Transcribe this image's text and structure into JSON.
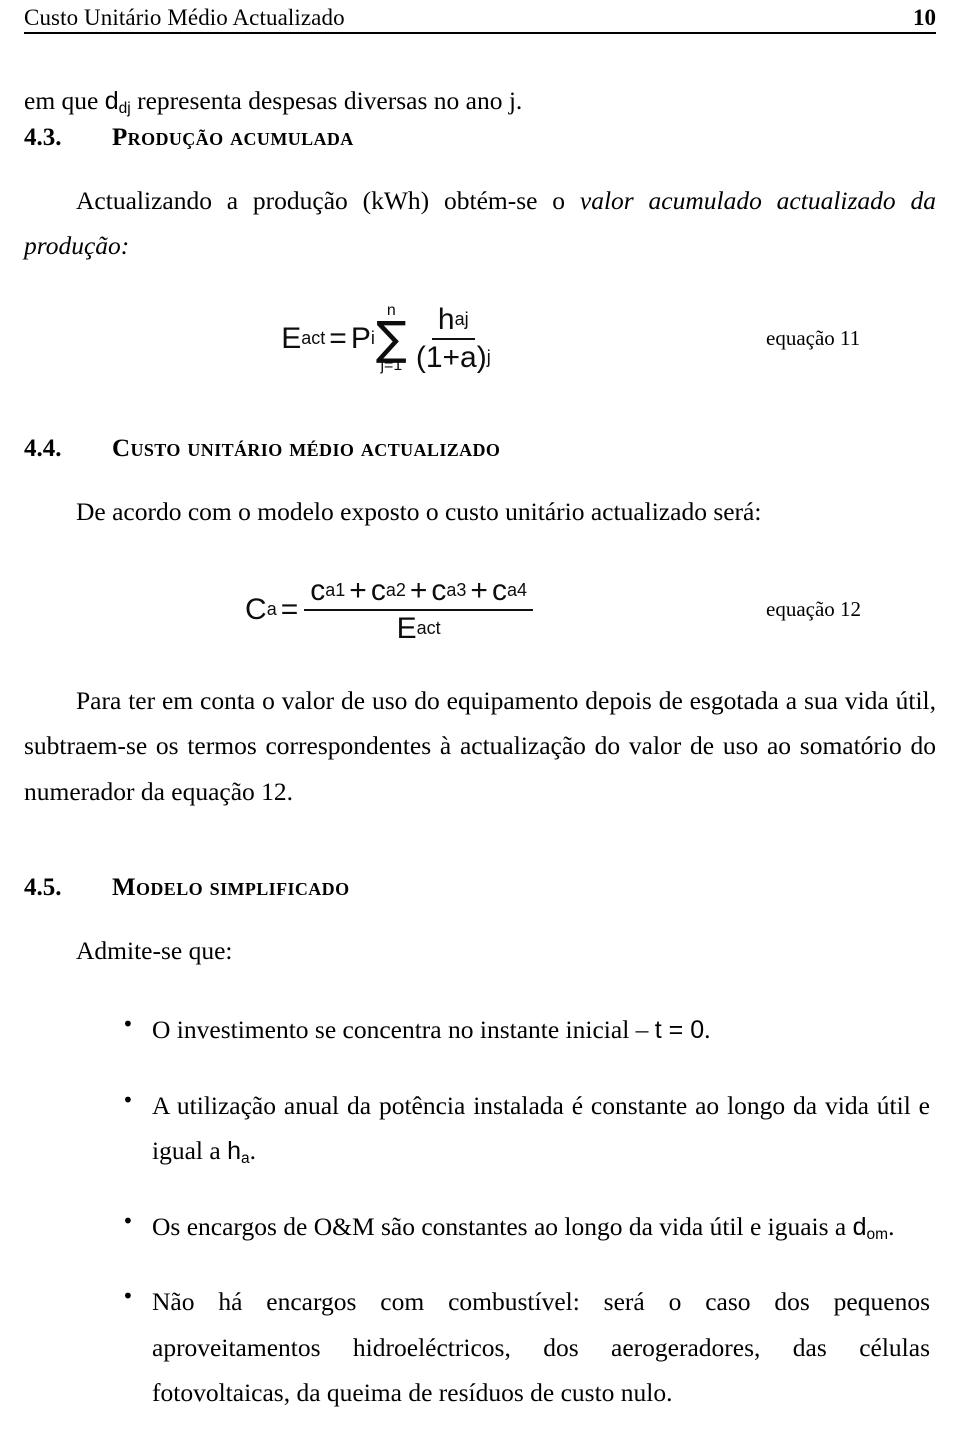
{
  "header": {
    "title": "Custo Unitário Médio Actualizado",
    "page_number": "10"
  },
  "intro": {
    "text_before": "em que ",
    "symbol": "d",
    "symbol_sub": "dj",
    "text_after": " representa despesas diversas no ano j."
  },
  "sections": [
    {
      "number": "4.3.",
      "title": "Produção acumulada",
      "paragraph_plain": "Actualizando a produção (kWh) obtém-se o ",
      "paragraph_italic": "valor acumulado actualizado da produção",
      "paragraph_tail": ":"
    },
    {
      "number": "4.4.",
      "title": "Custo unitário médio actualizado",
      "paragraph": "De acordo com o modelo exposto o custo unitário actualizado será:"
    },
    {
      "number": "4.5.",
      "title": "Modelo simplificado",
      "paragraph": "Admite-se que:"
    }
  ],
  "equations": [
    {
      "id": "equation-11",
      "label": "equação 11",
      "lhs_base": "E",
      "lhs_sub": "act",
      "equals": "=",
      "factor_base": "P",
      "factor_sub": "i",
      "sum_upper": "n",
      "sum_lower": "j=1",
      "sigma": "∑",
      "numerator_base": "h",
      "numerator_sub": "aj",
      "denominator": "(1+a)",
      "denominator_sup": "j"
    },
    {
      "id": "equation-12",
      "label": "equação 12",
      "lhs_base": "C",
      "lhs_sub": "a",
      "equals": "=",
      "numerator_terms": [
        {
          "base": "c",
          "sub": "a1"
        },
        {
          "base": "c",
          "sub": "a2"
        },
        {
          "base": "c",
          "sub": "a3"
        },
        {
          "base": "c",
          "sub": "a4"
        }
      ],
      "numerator_operator": "+",
      "denominator_base": "E",
      "denominator_sub": "act"
    }
  ],
  "paragraphs": {
    "after_equation_12": "Para ter em conta o valor de uso do equipamento depois de esgotada a sua vida útil, subtraem-se os termos correspondentes à actualização do valor de uso ao somatório do numerador da equação 12."
  },
  "bullets": {
    "marker": "•",
    "items": [
      {
        "parts": [
          {
            "type": "text",
            "value": "O investimento se concentra no instante inicial – "
          },
          {
            "type": "sym",
            "value": "t = 0"
          },
          {
            "type": "text",
            "value": "."
          }
        ]
      },
      {
        "parts": [
          {
            "type": "text",
            "value": "A utilização anual da potência instalada é constante ao longo da vida útil e igual a "
          },
          {
            "type": "sym_sub",
            "base": "h",
            "sub": "a"
          },
          {
            "type": "text",
            "value": "."
          }
        ]
      },
      {
        "parts": [
          {
            "type": "text",
            "value": "Os encargos de O&M são constantes ao longo da vida útil e iguais a "
          },
          {
            "type": "sym_sub",
            "base": "d",
            "sub": "om"
          },
          {
            "type": "text",
            "value": "."
          }
        ]
      },
      {
        "parts": [
          {
            "type": "text",
            "value": "Não há encargos com combustível: será o caso dos pequenos aproveitamentos hidroeléctricos, dos aerogeradores, das células fotovoltaicas, da queima de resíduos de custo nulo."
          }
        ]
      }
    ]
  }
}
